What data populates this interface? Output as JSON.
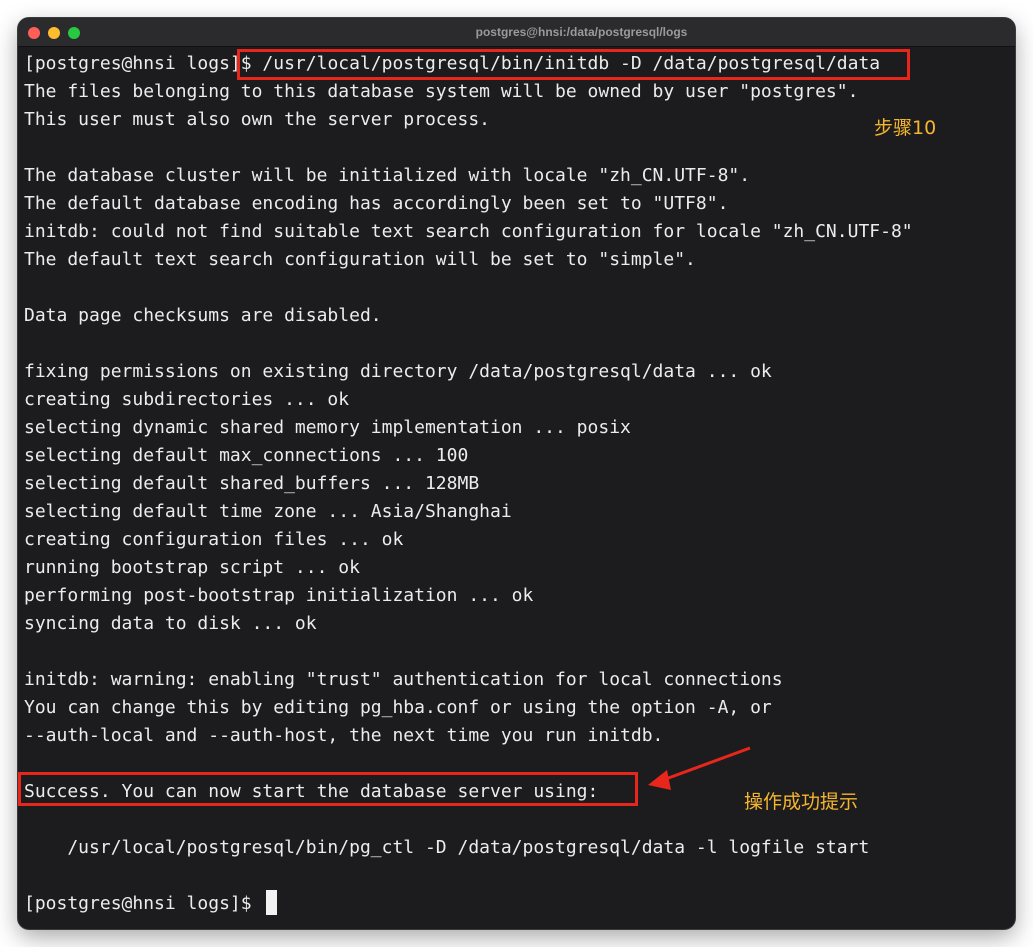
{
  "window": {
    "title": "postgres@hnsi:/data/postgresql/logs"
  },
  "terminal": {
    "prompt_prefix": "[postgres@hnsi logs]",
    "command": "$ /usr/local/postgresql/bin/initdb -D /data/postgresql/data",
    "lines": [
      "The files belonging to this database system will be owned by user \"postgres\".",
      "This user must also own the server process.",
      "",
      "The database cluster will be initialized with locale \"zh_CN.UTF-8\".",
      "The default database encoding has accordingly been set to \"UTF8\".",
      "initdb: could not find suitable text search configuration for locale \"zh_CN.UTF-8\"",
      "The default text search configuration will be set to \"simple\".",
      "",
      "Data page checksums are disabled.",
      "",
      "fixing permissions on existing directory /data/postgresql/data ... ok",
      "creating subdirectories ... ok",
      "selecting dynamic shared memory implementation ... posix",
      "selecting default max_connections ... 100",
      "selecting default shared_buffers ... 128MB",
      "selecting default time zone ... Asia/Shanghai",
      "creating configuration files ... ok",
      "running bootstrap script ... ok",
      "performing post-bootstrap initialization ... ok",
      "syncing data to disk ... ok",
      "",
      "initdb: warning: enabling \"trust\" authentication for local connections",
      "You can change this by editing pg_hba.conf or using the option -A, or",
      "--auth-local and --auth-host, the next time you run initdb.",
      "",
      "Success. You can now start the database server using:",
      "",
      "    /usr/local/postgresql/bin/pg_ctl -D /data/postgresql/data -l logfile start",
      ""
    ],
    "final_prompt": "[postgres@hnsi logs]$ "
  },
  "annotations": {
    "step_label": "步骤10",
    "success_label": "操作成功提示",
    "highlight_color": "#e8261c",
    "label_color": "#f5b52e"
  }
}
